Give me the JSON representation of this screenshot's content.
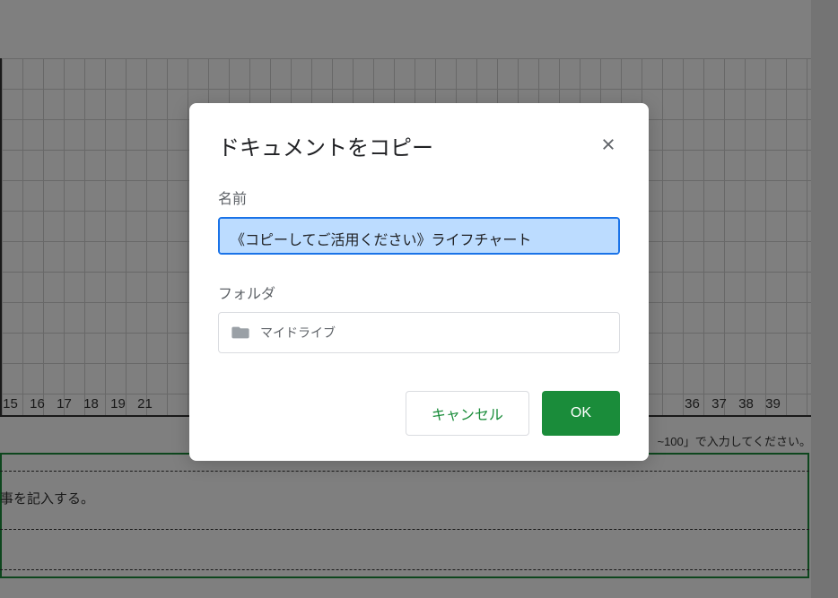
{
  "background": {
    "axis_numbers_left": [
      "15",
      "16",
      "17",
      "18",
      "19",
      "21"
    ],
    "axis_numbers_right": [
      "36",
      "37",
      "38",
      "39"
    ],
    "right_note": "~100」で入力してください。",
    "instruction": "事を記入する。"
  },
  "modal": {
    "title": "ドキュメントをコピー",
    "name_label": "名前",
    "name_value": "《コピーしてご活用ください》ライフチャート",
    "folder_label": "フォルダ",
    "folder_name": "マイドライブ",
    "cancel_button": "キャンセル",
    "ok_button": "OK"
  }
}
